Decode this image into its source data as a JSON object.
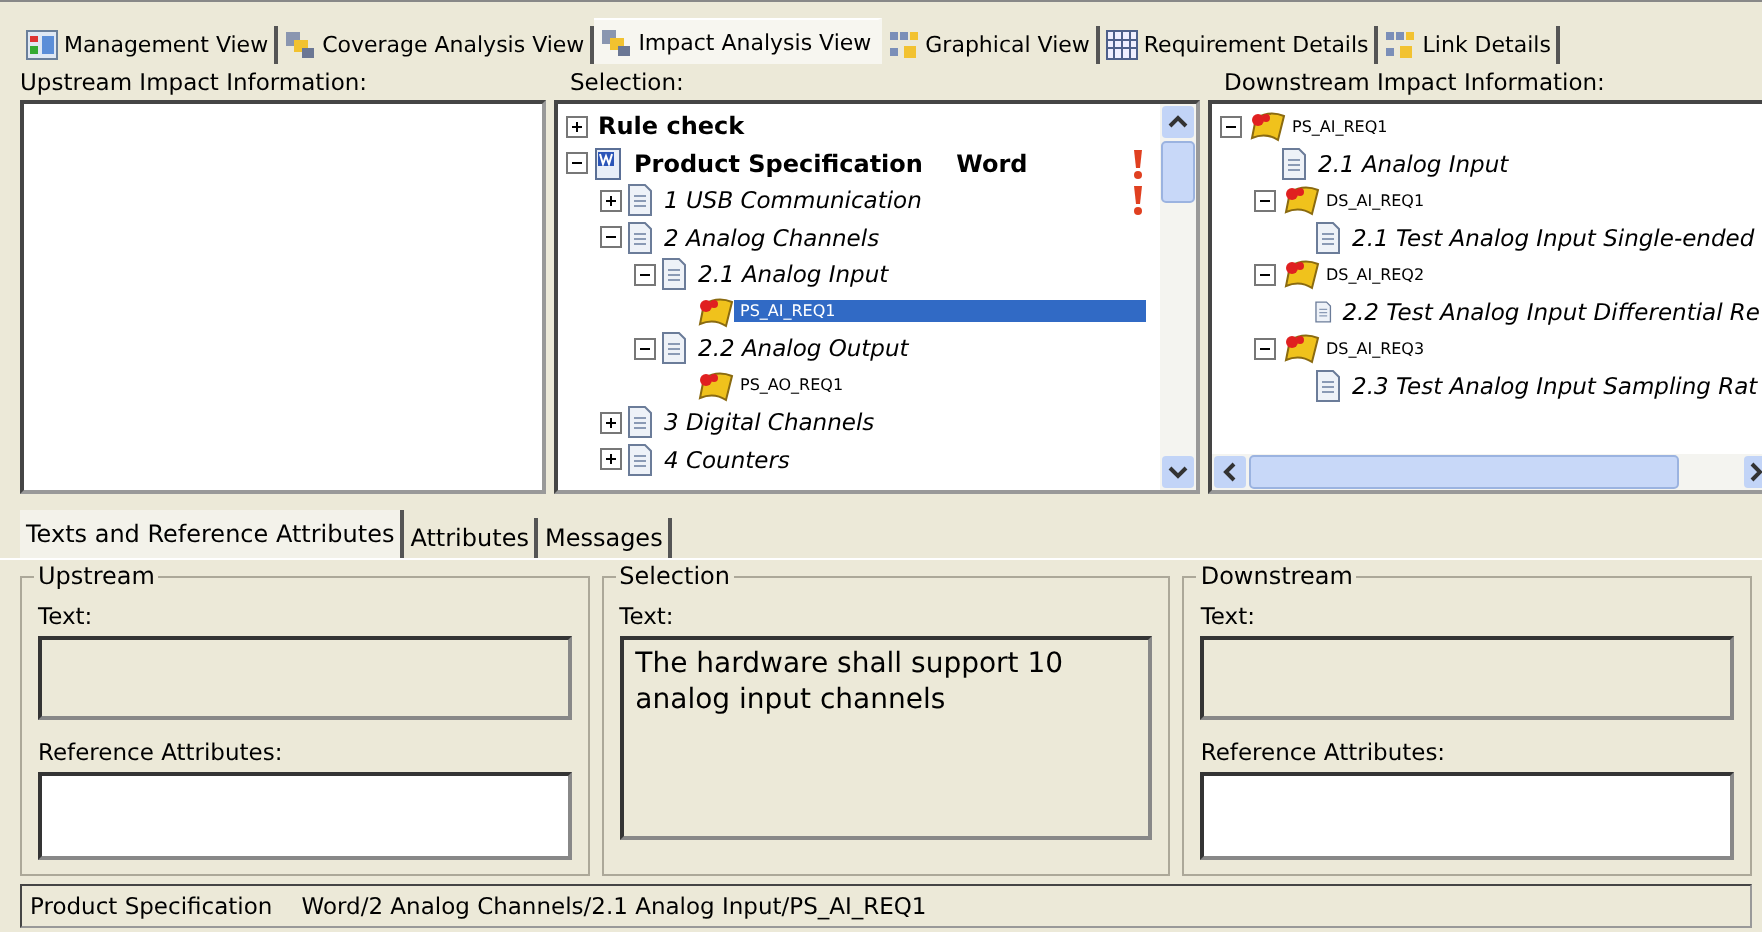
{
  "view_tabs": [
    {
      "label": "Management View",
      "selected": false
    },
    {
      "label": "Coverage Analysis View",
      "selected": false
    },
    {
      "label": "Impact Analysis View",
      "selected": true
    },
    {
      "label": "Graphical View",
      "selected": false
    },
    {
      "label": "Requirement Details",
      "selected": false
    },
    {
      "label": "Link Details",
      "selected": false
    }
  ],
  "upstream_pane": {
    "heading": "Upstream Impact Information:"
  },
  "selection_pane": {
    "heading": "Selection:",
    "tree": [
      {
        "kind": "folder",
        "label": "Rule check",
        "expanded": false,
        "flagged": false,
        "selected": false
      },
      {
        "kind": "document",
        "label": "Product Specification    Word",
        "expanded": true,
        "flagged": true,
        "selected": false,
        "children": [
          {
            "kind": "section",
            "label": "1 USB Communication",
            "expanded": false,
            "flagged": true,
            "selected": false
          },
          {
            "kind": "section",
            "label": "2 Analog Channels",
            "expanded": true,
            "flagged": false,
            "selected": false,
            "children": [
              {
                "kind": "section",
                "label": "2.1 Analog Input",
                "expanded": true,
                "flagged": false,
                "selected": false,
                "children": [
                  {
                    "kind": "requirement",
                    "label": "PS_AI_REQ1",
                    "flagged": false,
                    "selected": true
                  }
                ]
              },
              {
                "kind": "section",
                "label": "2.2 Analog Output",
                "expanded": true,
                "flagged": false,
                "selected": false,
                "children": [
                  {
                    "kind": "requirement",
                    "label": "PS_AO_REQ1",
                    "flagged": false,
                    "selected": false
                  }
                ]
              }
            ]
          },
          {
            "kind": "section",
            "label": "3 Digital Channels",
            "expanded": false,
            "flagged": false,
            "selected": false
          },
          {
            "kind": "section",
            "label": "4 Counters",
            "expanded": false,
            "flagged": false,
            "selected": false
          }
        ]
      }
    ]
  },
  "downstream_pane": {
    "heading": "Downstream Impact Information:",
    "tree": [
      {
        "kind": "requirement",
        "label": "PS_AI_REQ1",
        "expanded": true,
        "flagged": false,
        "selected": false,
        "children": [
          {
            "kind": "section",
            "label": "2.1 Analog Input",
            "flagged": false,
            "selected": false
          },
          {
            "kind": "requirement",
            "label": "DS_AI_REQ1",
            "expanded": true,
            "flagged": false,
            "selected": false,
            "children": [
              {
                "kind": "section",
                "label": "2.1 Test Analog Input Single-ended",
                "flagged": false,
                "selected": false
              }
            ]
          },
          {
            "kind": "requirement",
            "label": "DS_AI_REQ2",
            "expanded": true,
            "flagged": false,
            "selected": false,
            "children": [
              {
                "kind": "section",
                "label": "2.2 Test Analog Input Differential Re",
                "flagged": false,
                "selected": false
              }
            ]
          },
          {
            "kind": "requirement",
            "label": "DS_AI_REQ3",
            "expanded": true,
            "flagged": false,
            "selected": false,
            "children": [
              {
                "kind": "section",
                "label": "2.3 Test Analog Input Sampling Rat",
                "flagged": false,
                "selected": false
              }
            ]
          }
        ]
      }
    ]
  },
  "detail_tabs": [
    {
      "label": "Texts and Reference Attributes",
      "selected": true
    },
    {
      "label": "Attributes",
      "selected": false
    },
    {
      "label": "Messages",
      "selected": false
    }
  ],
  "groups": [
    {
      "title": "Upstream",
      "text_label": "Text:",
      "reference_label": "Reference Attributes:"
    },
    {
      "title": "Selection",
      "text_label": "Text:",
      "text": "The hardware shall support 10 analog input channels"
    },
    {
      "title": "Downstream",
      "text_label": "Text:",
      "reference_label": "Reference Attributes:"
    }
  ],
  "status_bar": "Product Specification    Word/2 Analog Channels/2.1 Analog Input/PS_AI_REQ1"
}
